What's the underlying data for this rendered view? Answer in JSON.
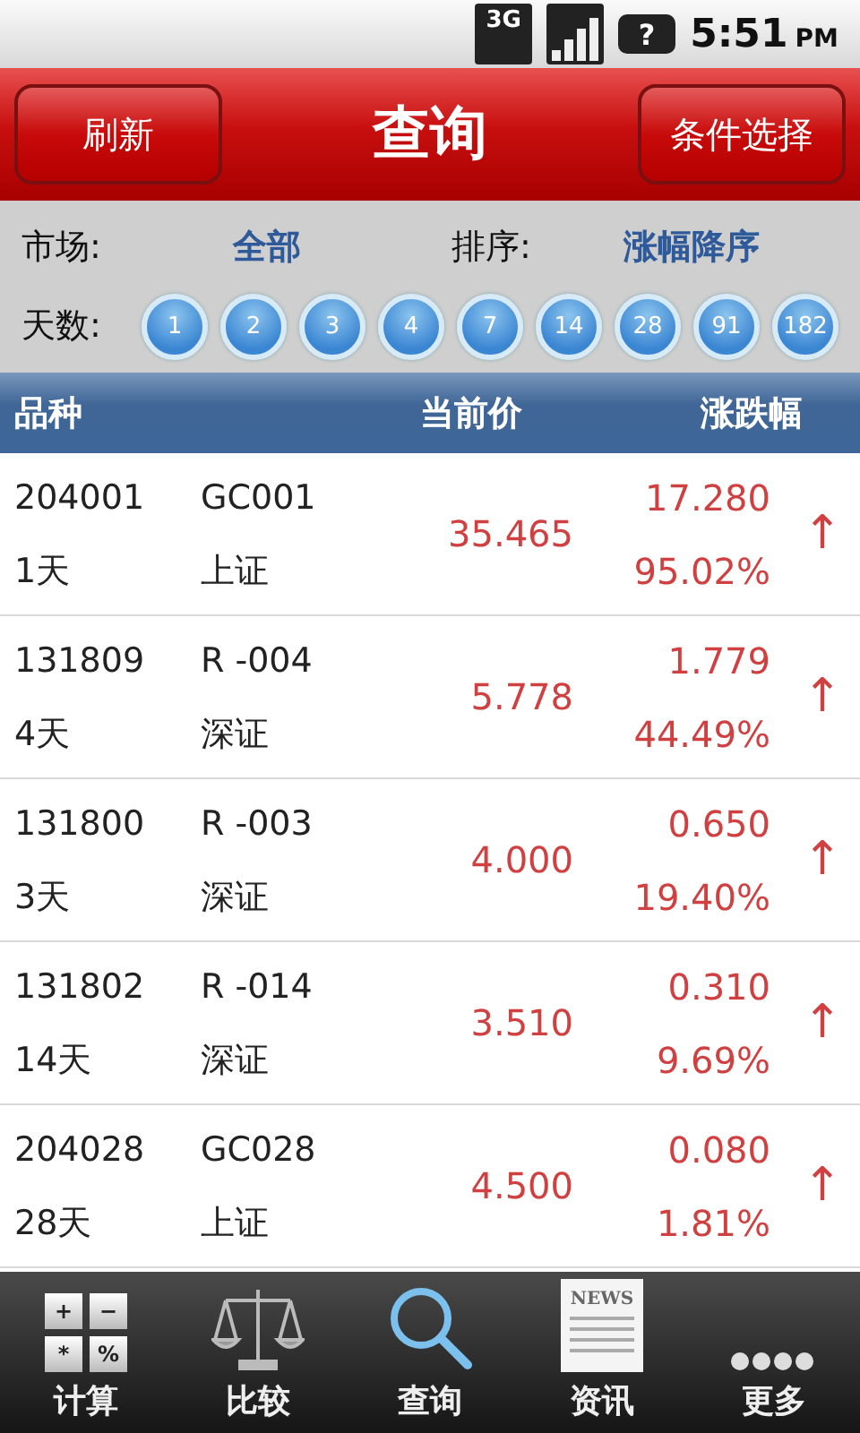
{
  "status_bar": {
    "network": "3G",
    "battery_mark": "?",
    "time": "5:51",
    "ampm": "PM"
  },
  "header": {
    "left_button": "刷新",
    "title": "查询",
    "right_button": "条件选择"
  },
  "filters": {
    "market_label": "市场:",
    "market_value": "全部",
    "sort_label": "排序:",
    "sort_value": "涨幅降序",
    "days_label": "天数:",
    "days": [
      "1",
      "2",
      "3",
      "4",
      "7",
      "14",
      "28",
      "91",
      "182"
    ]
  },
  "table": {
    "columns": [
      "品种",
      "当前价",
      "涨跌幅"
    ],
    "rows": [
      {
        "code": "204001",
        "name": "GC001",
        "term": "1天",
        "market": "上证",
        "price": "35.465",
        "change": "17.280",
        "percent": "95.02%",
        "arrow": "↑"
      },
      {
        "code": "131809",
        "name": "R -004",
        "term": "4天",
        "market": "深证",
        "price": "5.778",
        "change": "1.779",
        "percent": "44.49%",
        "arrow": "↑"
      },
      {
        "code": "131800",
        "name": "R -003",
        "term": "3天",
        "market": "深证",
        "price": "4.000",
        "change": "0.650",
        "percent": "19.40%",
        "arrow": "↑"
      },
      {
        "code": "131802",
        "name": "R -014",
        "term": "14天",
        "market": "深证",
        "price": "3.510",
        "change": "0.310",
        "percent": "9.69%",
        "arrow": "↑"
      },
      {
        "code": "204028",
        "name": "GC028",
        "term": "28天",
        "market": "上证",
        "price": "4.500",
        "change": "0.080",
        "percent": "1.81%",
        "arrow": "↑"
      }
    ]
  },
  "tab_bar": [
    {
      "kind": "calculator",
      "label": "计算",
      "keys": [
        "+",
        "−",
        "*",
        "%"
      ]
    },
    {
      "kind": "scale",
      "label": "比较"
    },
    {
      "kind": "search",
      "label": "查询"
    },
    {
      "kind": "news",
      "label": "资讯",
      "icon_text": "NEWS"
    },
    {
      "kind": "more",
      "label": "更多"
    }
  ]
}
